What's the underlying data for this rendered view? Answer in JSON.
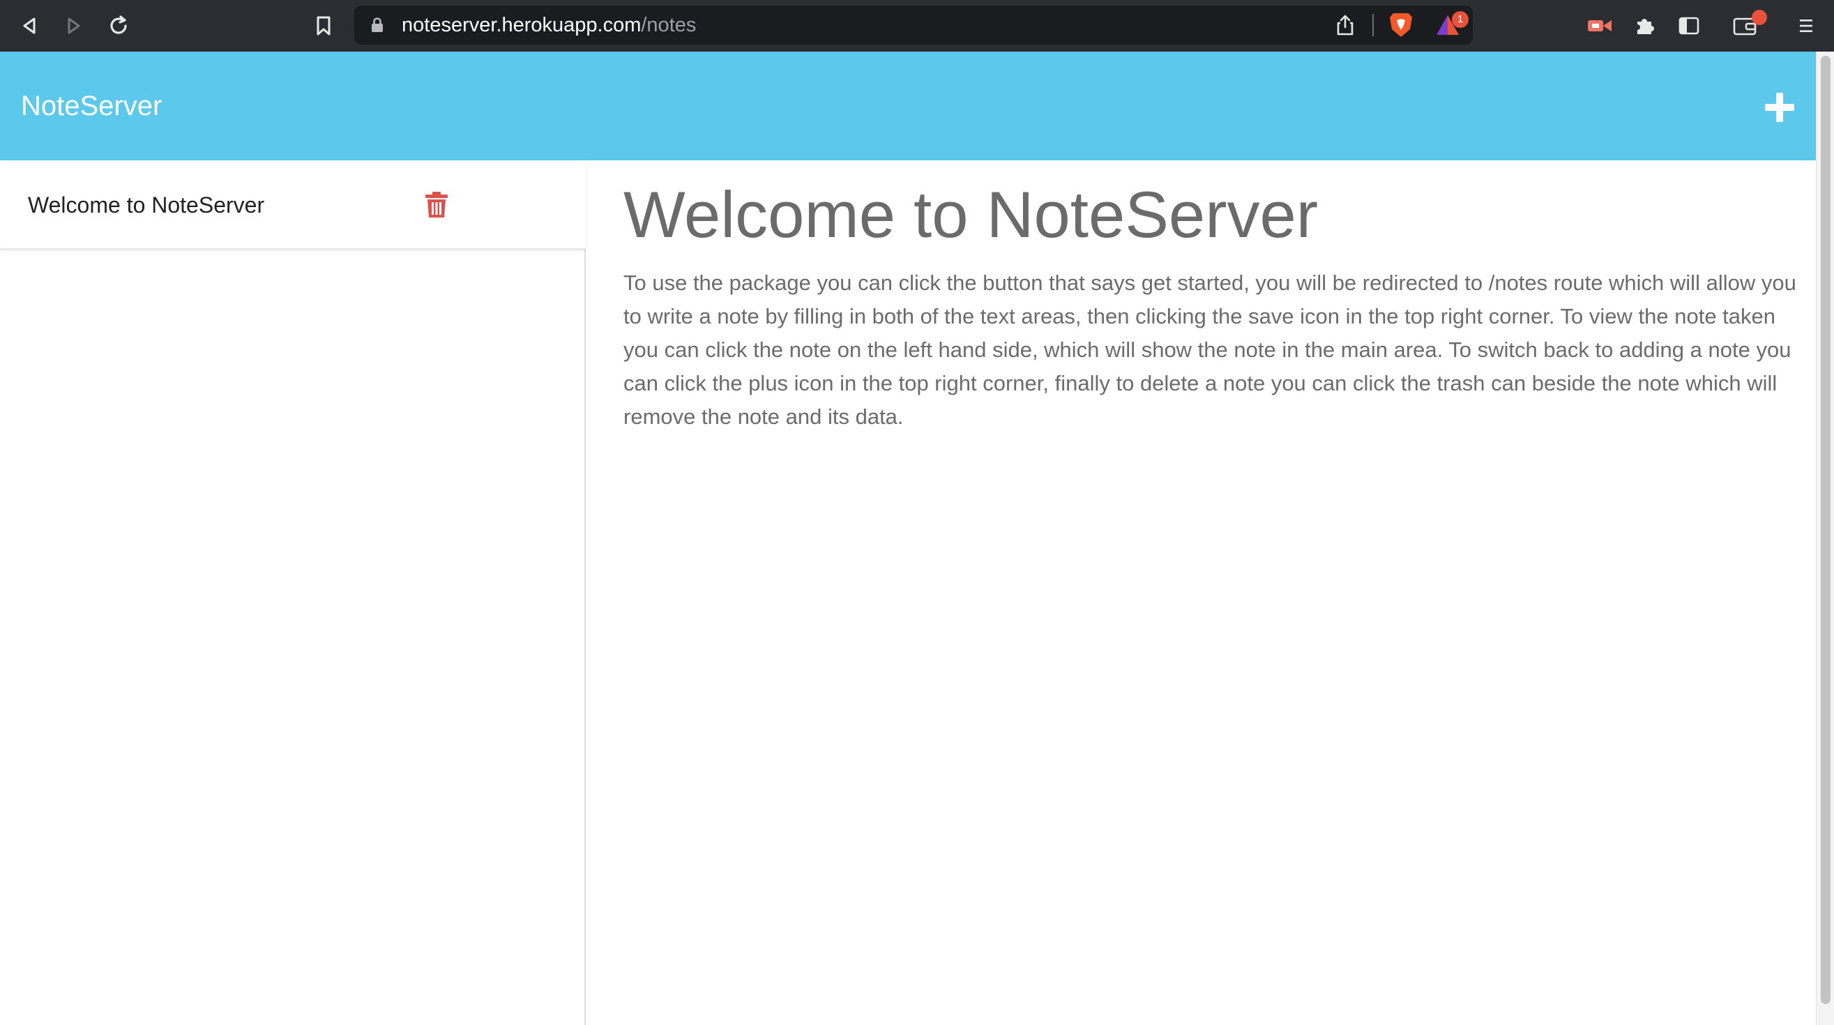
{
  "browser": {
    "url_host": "noteserver.herokuapp.com",
    "url_path": "/notes",
    "rewards_badge_count": "1",
    "accent_badge_color": "#e8523b"
  },
  "app": {
    "brand": "NoteServer",
    "header_color": "#5bc8ec",
    "add_icon": "plus-icon"
  },
  "sidebar": {
    "notes": [
      {
        "title": "Welcome to NoteServer",
        "delete_icon": "trash-icon",
        "delete_color": "#d9534f"
      }
    ]
  },
  "main": {
    "title": "Welcome to NoteServer",
    "body": "To use the package you can click the button that says get started, you will be redirected to /notes route which will allow you to write a note by filling in both of the text areas, then clicking the save icon in the top right corner. To view the note taken you can click the note on the left hand side, which will show the note in the main area. To switch back to adding a note you can click the plus icon in the top right corner, finally to delete a note you can click the trash can beside the note which will remove the note and its data."
  }
}
